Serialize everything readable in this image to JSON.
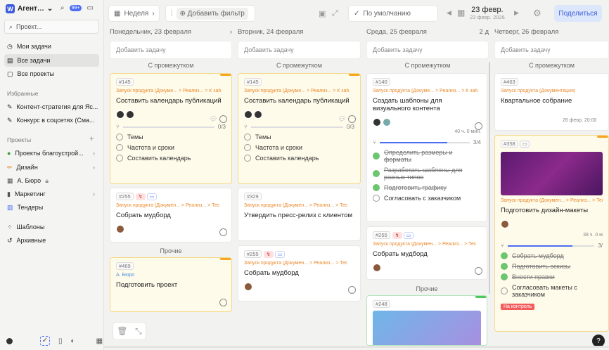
{
  "sidebar": {
    "workspace": "Агент…",
    "badge": "99+",
    "search_placeholder": "Проект...",
    "items": [
      {
        "label": "Мои задачи"
      },
      {
        "label": "Все задачи"
      },
      {
        "label": "Все проекты"
      }
    ],
    "favorites_title": "Избранные",
    "favorites": [
      {
        "label": "Контент-стратегия для Яс..."
      },
      {
        "label": "Конкурс в соцсетях (Сма..."
      }
    ],
    "projects_title": "Проекты",
    "projects": [
      {
        "label": "Проекты благоустрой..."
      },
      {
        "label": "Дизайн"
      },
      {
        "label": "А. Бюро"
      },
      {
        "label": "Маркетинг"
      },
      {
        "label": "Тендеры"
      }
    ],
    "templates": "Шаблоны",
    "archive": "Архивные"
  },
  "toolbar": {
    "period": "Неделя",
    "add_filter": "Добавить фильтр",
    "sort": "По умолчанию",
    "date_main": "23 февр.",
    "date_sub": "23 февр. 2026",
    "share": "Поделиться"
  },
  "add_task": "Добавить задачу",
  "group_gap": "С промежутком",
  "group_other": "Прочие",
  "columns": [
    {
      "title": "Понедельник, 23 февраля"
    },
    {
      "title": "Вторник, 24 февраля"
    },
    {
      "title": "Среда, 25 февраля",
      "count": "2 д"
    },
    {
      "title": "Четверг, 26 февраля"
    }
  ],
  "cards": {
    "c1": {
      "id": "#145",
      "crumb": "Запуск продукта (Докуме... > Реализ... > К заб",
      "title": "Составить календарь публикаций",
      "prog": "0/3",
      "subs": [
        "Темы",
        "Частота и сроки",
        "Составить календарь"
      ]
    },
    "c2": {
      "id": "#255",
      "crumb": "Запуск продукта (Докумен... > Реализ... > Тес",
      "title": "Собрать мудборд"
    },
    "c3": {
      "id": "#469",
      "crumb": "А. Бюро",
      "title": "Подготовить проект"
    },
    "c4": {
      "id": "#145",
      "crumb": "Запуск продукта (Докуме... > Реализ... > К заб",
      "title": "Составить календарь публикаций",
      "prog": "0/3",
      "subs": [
        "Темы",
        "Частота и сроки",
        "Составить календарь"
      ]
    },
    "c5": {
      "id": "#329",
      "crumb": "Запуск продукта (Докумен... > Реализ... > Тес",
      "title": "Утвердить пресс-релиз с клиентом"
    },
    "c6": {
      "id": "#255",
      "crumb": "Запуск продукта (Докумен... > Реализ... > Тес",
      "title": "Собрать мудборд"
    },
    "c7": {
      "id": "#140",
      "crumb": "Запуск продукта (Докуме... > Реализ... > К заб",
      "title": "Создать шаблоны для визуального контента",
      "meta": "40 ч. 0 мин.",
      "prog": "3/4",
      "subs": [
        "Определить размеры и форматы",
        "Разработать шаблоны для разных типов",
        "Подготовить графику",
        "Согласовать с заказчиком"
      ]
    },
    "c8": {
      "id": "#255",
      "crumb": "Запуск продукта (Докумен... > Реализ... > Тес",
      "title": "Собрать мудборд"
    },
    "c9": {
      "id": "#248"
    },
    "c10": {
      "id": "#463",
      "crumb": "Запуск продукта (Документация)",
      "title": "Квартальное собрание",
      "meta": "26 февр. 20:00"
    },
    "c11": {
      "id": "#358",
      "crumb": "Запуск продукта (Докумен... > Реализ... > Тес",
      "title": "Подготовить дизайн-макеты",
      "meta": "38 ч. 0 м",
      "prog": "3/",
      "subs": [
        "Собрать мудборд",
        "Подготовить эскизы",
        "Внести правки",
        "Согласовать макеты с заказчиком"
      ],
      "tag": "На контроль"
    }
  },
  "colors": {
    "accent": "#4c6ef5",
    "yellow": "#fffbea",
    "orange": "#e8892b"
  }
}
